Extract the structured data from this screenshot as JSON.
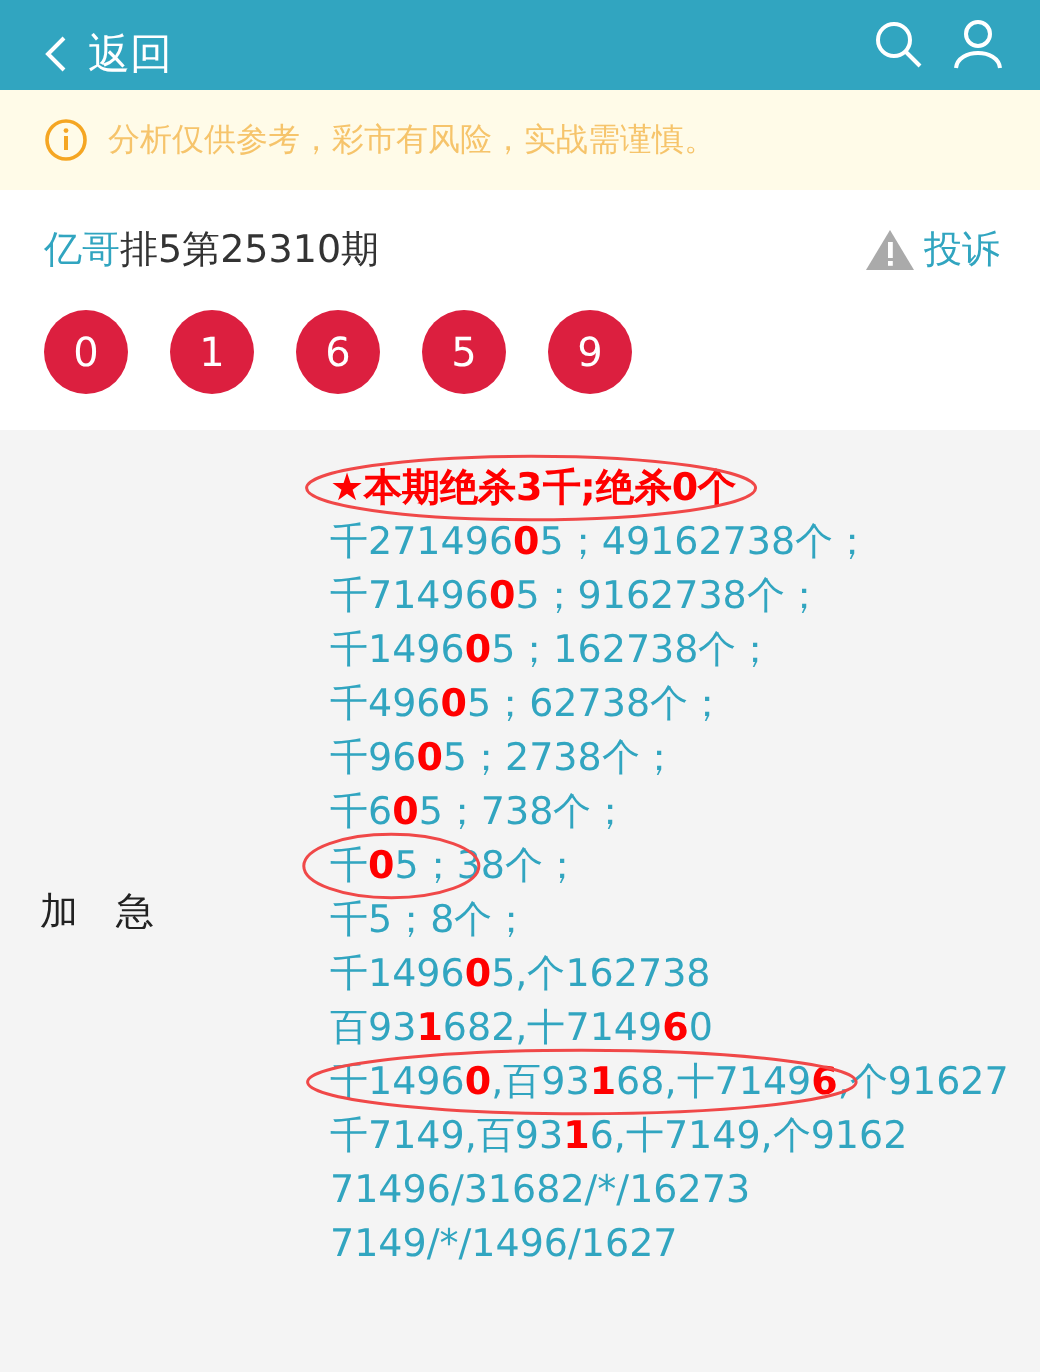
{
  "header": {
    "back_label": "返回"
  },
  "notice": {
    "text": "分析仅供参考，彩市有风险，实战需谨慎。"
  },
  "title": {
    "author": "亿哥",
    "issue": "排5第25310期",
    "report_label": "投诉"
  },
  "balls": [
    "0",
    "1",
    "6",
    "5",
    "9"
  ],
  "section": {
    "label": "加　急",
    "lines": [
      {
        "kind": "headline",
        "parts": [
          {
            "text": "★本期绝杀3千;绝杀0个",
            "circled": true
          }
        ]
      },
      {
        "kind": "normal",
        "parts": [
          {
            "text": "千271496**0**5；49162738个；",
            "circled": false
          }
        ]
      },
      {
        "kind": "normal",
        "parts": [
          {
            "text": "千71496**0**5；9162738个；",
            "circled": false
          }
        ]
      },
      {
        "kind": "normal",
        "parts": [
          {
            "text": "千1496**0**5；162738个；",
            "circled": false
          }
        ]
      },
      {
        "kind": "normal",
        "parts": [
          {
            "text": "千496**0**5；62738个；",
            "circled": false
          }
        ]
      },
      {
        "kind": "normal",
        "parts": [
          {
            "text": "千96**0**5；2738个；",
            "circled": false
          }
        ]
      },
      {
        "kind": "normal",
        "parts": [
          {
            "text": "千6**0**5；738个；",
            "circled": false
          }
        ]
      },
      {
        "kind": "normal",
        "parts": [
          {
            "text": "千**0**5；",
            "circled": true
          },
          {
            "text": "38个；",
            "circled": false
          }
        ]
      },
      {
        "kind": "normal",
        "parts": [
          {
            "text": "千5；8个；",
            "circled": false
          }
        ]
      },
      {
        "kind": "normal",
        "parts": [
          {
            "text": "千1496**0**5,个162738",
            "circled": false
          }
        ]
      },
      {
        "kind": "normal",
        "parts": [
          {
            "text": "百93**1**682,十7149**6**0",
            "circled": false
          }
        ]
      },
      {
        "kind": "normal",
        "parts": [
          {
            "text": "千1496**0**,百93**1**68,十7149**6**",
            "circled": true
          },
          {
            "text": ",个91627",
            "circled": false
          }
        ]
      },
      {
        "kind": "normal",
        "parts": [
          {
            "text": "千7149,百93**1**6,十7149,个9162",
            "circled": false
          }
        ]
      },
      {
        "kind": "normal",
        "parts": [
          {
            "text": "71496/31682/*/16273",
            "circled": false
          }
        ]
      },
      {
        "kind": "normal",
        "parts": [
          {
            "text": "7149/*/1496/1627",
            "circled": false
          }
        ]
      }
    ]
  }
}
